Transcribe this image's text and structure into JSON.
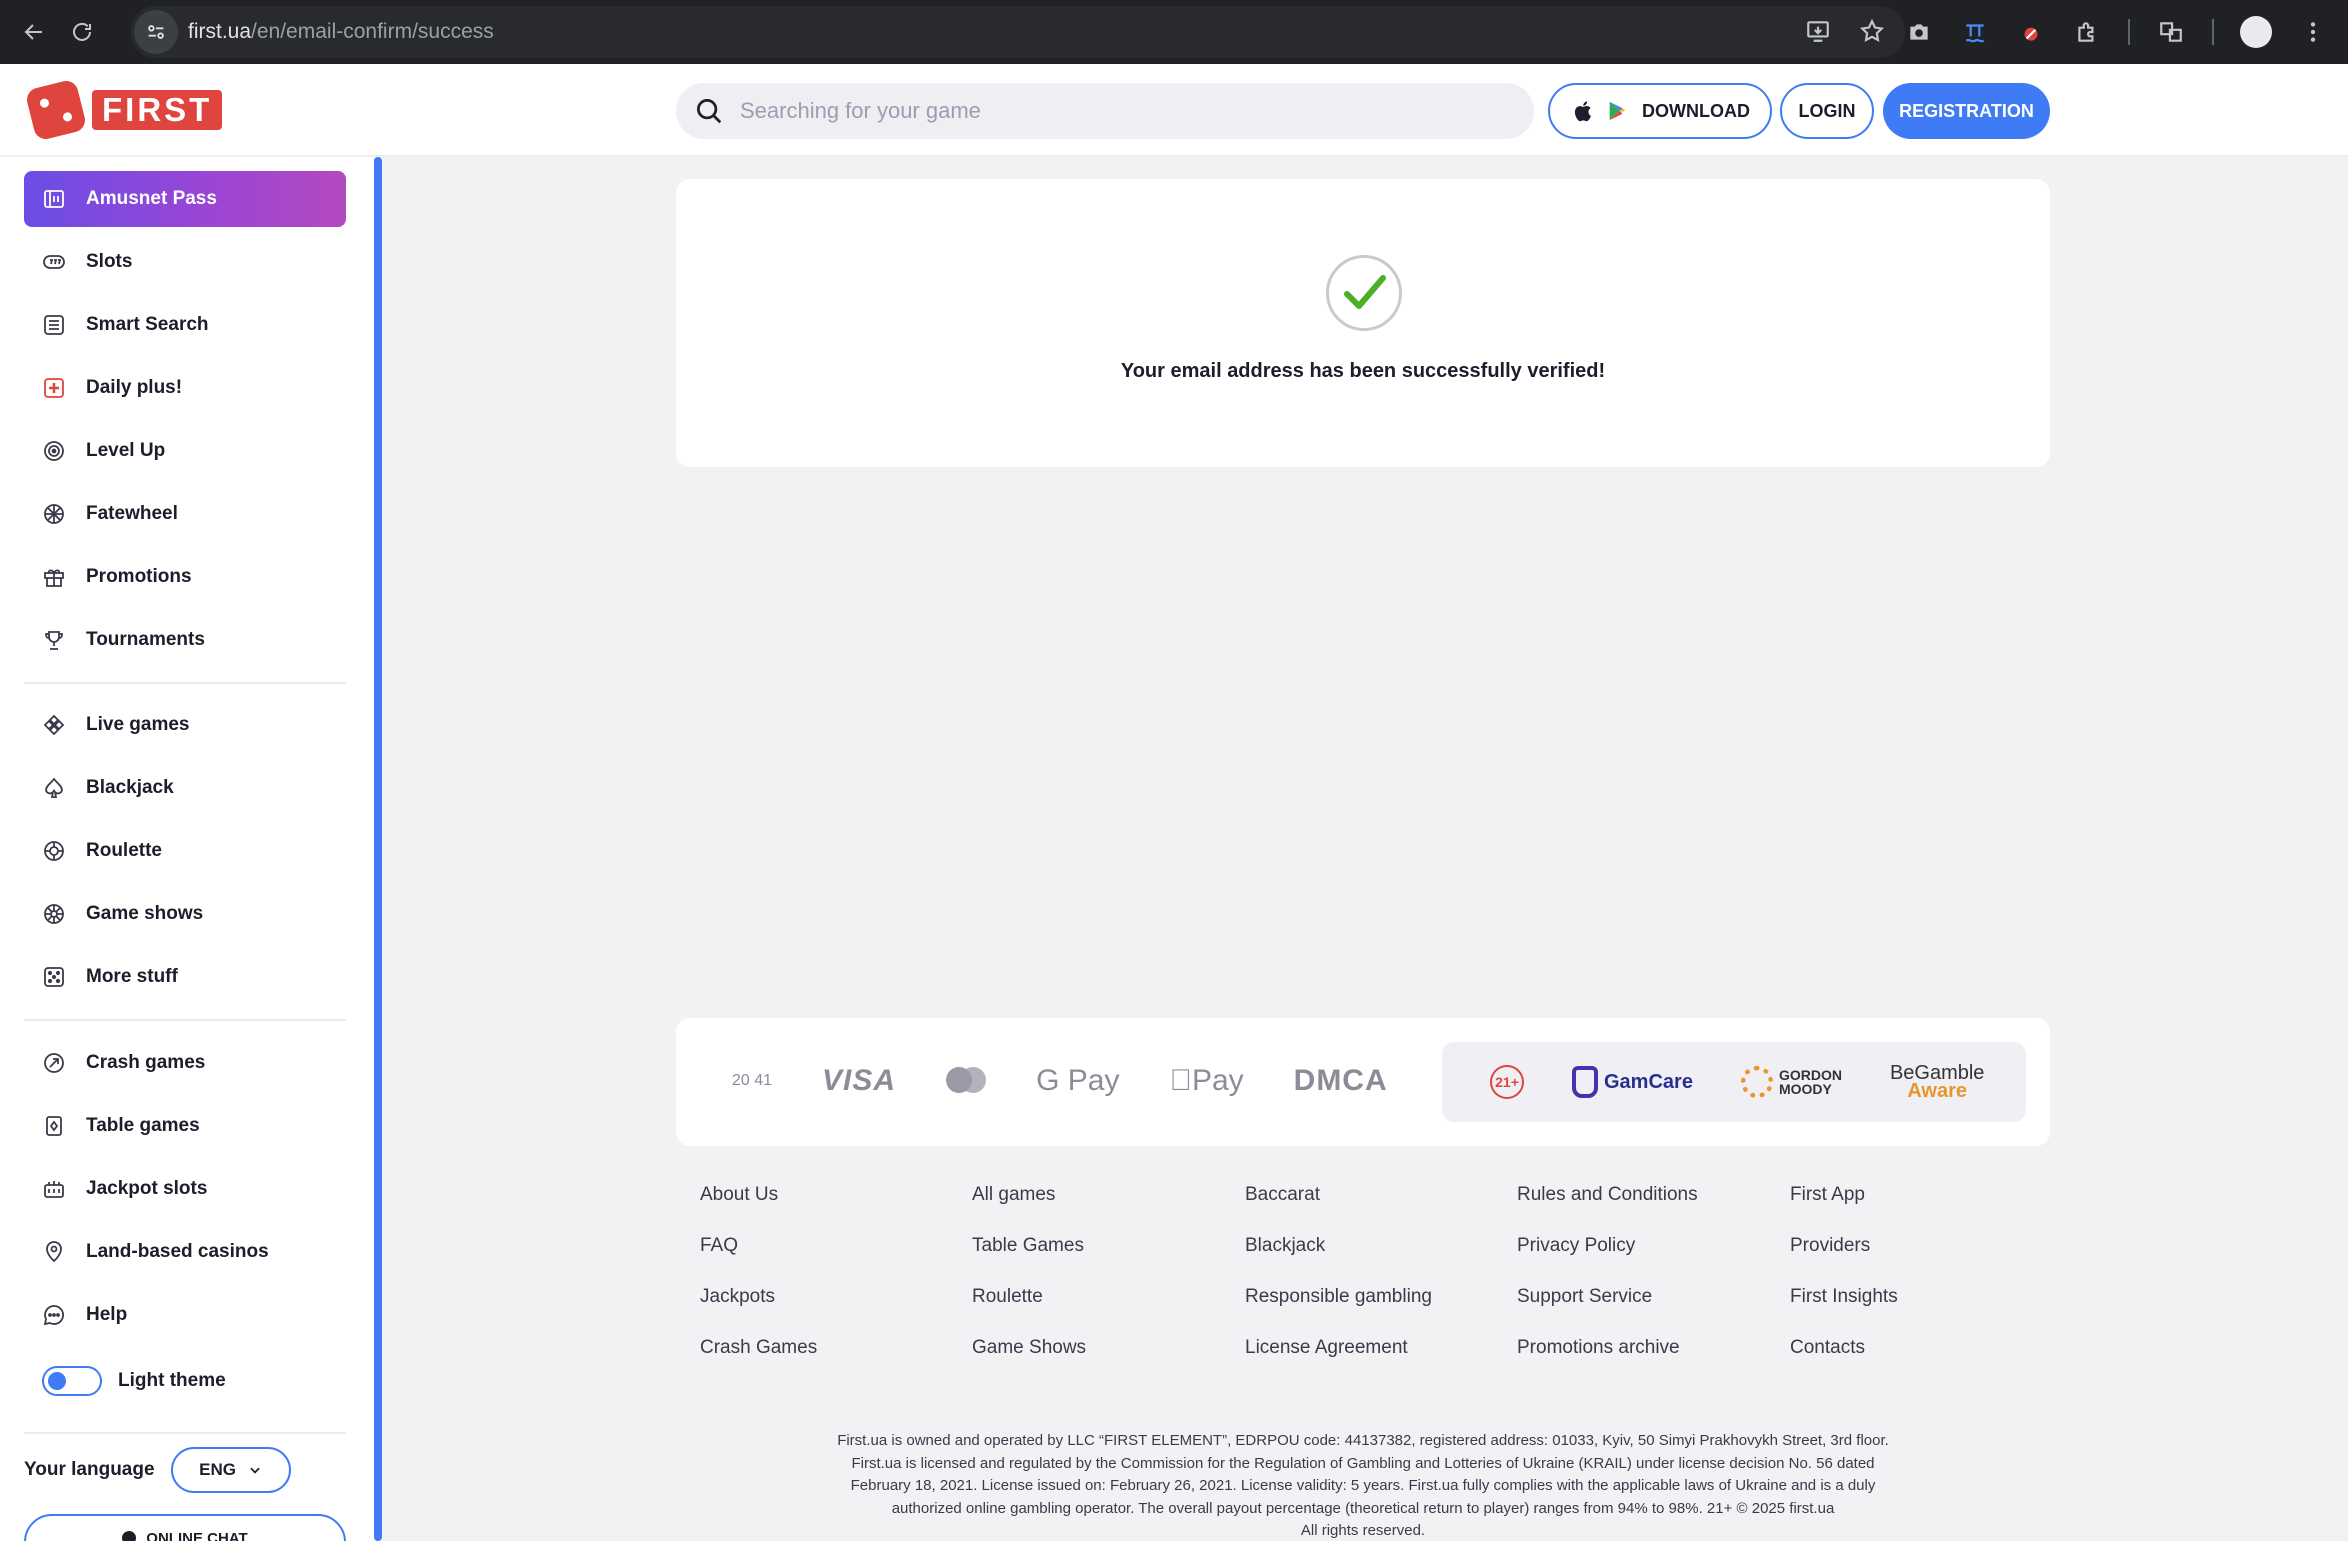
{
  "browser": {
    "url_host": "first.ua",
    "url_path": "/en/email-confirm/success"
  },
  "header": {
    "logo_text": "FIRST",
    "search_placeholder": "Searching for your game",
    "download_label": "DOWNLOAD",
    "login_label": "LOGIN",
    "registration_label": "REGISTRATION"
  },
  "sidebar": {
    "items": [
      {
        "label": "Amusnet Pass",
        "icon": "pass-icon"
      },
      {
        "label": "Slots",
        "icon": "slot-icon"
      },
      {
        "label": "Smart Search",
        "icon": "list-icon"
      },
      {
        "label": "Daily plus!",
        "icon": "plus-box-icon"
      },
      {
        "label": "Level Up",
        "icon": "target-icon"
      },
      {
        "label": "Fatewheel",
        "icon": "wheel-icon"
      },
      {
        "label": "Promotions",
        "icon": "gift-icon"
      },
      {
        "label": "Tournaments",
        "icon": "trophy-icon"
      }
    ],
    "items2": [
      {
        "label": "Live games",
        "icon": "diamonds-icon"
      },
      {
        "label": "Blackjack",
        "icon": "spade-icon"
      },
      {
        "label": "Roulette",
        "icon": "roulette-icon"
      },
      {
        "label": "Game shows",
        "icon": "show-wheel-icon"
      },
      {
        "label": "More stuff",
        "icon": "dice-icon"
      }
    ],
    "items3": [
      {
        "label": "Crash games",
        "icon": "rocket-icon"
      },
      {
        "label": "Table games",
        "icon": "card-icon"
      },
      {
        "label": "Jackpot slots",
        "icon": "jackpot-icon"
      },
      {
        "label": "Land-based casinos",
        "icon": "pin-icon"
      },
      {
        "label": "Help",
        "icon": "chat-icon"
      }
    ],
    "theme_label": "Light theme",
    "language_label": "Your language",
    "language_value": "ENG",
    "chat_label": "ONLINE CHAT"
  },
  "main": {
    "success_message": "Your email address has been successfully verified!"
  },
  "payments": {
    "p2041": "20 41",
    "visa": "VISA",
    "gpay": "G Pay",
    "apay": "Pay",
    "dmca": "DMCA",
    "r21": "21+",
    "gamcare": "GamCare",
    "gordon1": "GORDON",
    "gordon2": "MOODY",
    "begamble1": "BeGamble",
    "begamble2": "Aware"
  },
  "footer": {
    "col1": [
      "About Us",
      "FAQ",
      "Jackpots",
      "Crash Games"
    ],
    "col2": [
      "All games",
      "Table Games",
      "Roulette",
      "Game Shows"
    ],
    "col3": [
      "Baccarat",
      "Blackjack",
      "Responsible gambling",
      "License Agreement"
    ],
    "col4": [
      "Rules and Conditions",
      "Privacy Policy",
      "Support Service",
      "Promotions archive"
    ],
    "col5": [
      "First App",
      "Providers",
      "First Insights",
      "Contacts"
    ],
    "legal": [
      "First.ua is owned and operated by LLC “FIRST ELEMENT”, EDRPOU code: 44137382, registered address: 01033, Kyiv, 50 Simyi Prakhovykh Street, 3rd floor.",
      "First.ua is licensed and regulated by the Commission for the Regulation of Gambling and Lotteries of Ukraine (KRAIL) under license decision No. 56 dated",
      "February 18, 2021. License issued on: February 26, 2021. License validity: 5 years. First.ua fully complies with the applicable laws of Ukraine and is a duly",
      "authorized online gambling operator. The overall payout percentage (theoretical return to player) ranges from 94% to 98%. 21+ © 2025 first.ua",
      "All rights reserved."
    ]
  }
}
